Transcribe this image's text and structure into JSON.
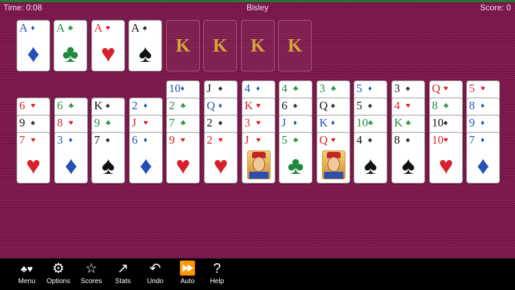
{
  "status": {
    "time": "Time: 0:08",
    "title": "Bisley",
    "score": "Score: 0"
  },
  "foundations": {
    "aces": [
      {
        "rank": "A",
        "suit": "diamonds"
      },
      {
        "rank": "A",
        "suit": "clubs"
      },
      {
        "rank": "A",
        "suit": "hearts"
      },
      {
        "rank": "A",
        "suit": "spades"
      }
    ],
    "king_slots": [
      "K",
      "K",
      "K",
      "K"
    ]
  },
  "tableau": [
    [
      {
        "rank": "6",
        "suit": "hearts"
      },
      {
        "rank": "9",
        "suit": "spades"
      },
      {
        "rank": "7",
        "suit": "hearts"
      }
    ],
    [
      {
        "rank": "6",
        "suit": "clubs"
      },
      {
        "rank": "8",
        "suit": "hearts"
      },
      {
        "rank": "3",
        "suit": "diamonds"
      }
    ],
    [
      {
        "rank": "K",
        "suit": "spades"
      },
      {
        "rank": "9",
        "suit": "clubs"
      },
      {
        "rank": "7",
        "suit": "spades"
      }
    ],
    [
      {
        "rank": "2",
        "suit": "diamonds"
      },
      {
        "rank": "J",
        "suit": "hearts"
      },
      {
        "rank": "6",
        "suit": "diamonds"
      }
    ],
    [
      {
        "rank": "10",
        "suit": "diamonds"
      },
      {
        "rank": "2",
        "suit": "clubs"
      },
      {
        "rank": "7",
        "suit": "clubs"
      },
      {
        "rank": "9",
        "suit": "hearts"
      }
    ],
    [
      {
        "rank": "J",
        "suit": "spades"
      },
      {
        "rank": "Q",
        "suit": "diamonds"
      },
      {
        "rank": "2",
        "suit": "spades"
      },
      {
        "rank": "2",
        "suit": "hearts"
      }
    ],
    [
      {
        "rank": "4",
        "suit": "diamonds"
      },
      {
        "rank": "K",
        "suit": "hearts"
      },
      {
        "rank": "3",
        "suit": "hearts"
      },
      {
        "rank": "J",
        "suit": "hearts"
      }
    ],
    [
      {
        "rank": "4",
        "suit": "clubs"
      },
      {
        "rank": "6",
        "suit": "spades"
      },
      {
        "rank": "J",
        "suit": "diamonds"
      },
      {
        "rank": "5",
        "suit": "clubs"
      }
    ],
    [
      {
        "rank": "3",
        "suit": "clubs"
      },
      {
        "rank": "Q",
        "suit": "spades"
      },
      {
        "rank": "K",
        "suit": "diamonds"
      },
      {
        "rank": "Q",
        "suit": "hearts"
      }
    ],
    [
      {
        "rank": "5",
        "suit": "diamonds"
      },
      {
        "rank": "5",
        "suit": "spades"
      },
      {
        "rank": "10",
        "suit": "clubs"
      },
      {
        "rank": "4",
        "suit": "spades"
      }
    ],
    [
      {
        "rank": "3",
        "suit": "spades"
      },
      {
        "rank": "4",
        "suit": "hearts"
      },
      {
        "rank": "K",
        "suit": "clubs"
      },
      {
        "rank": "8",
        "suit": "spades"
      }
    ],
    [
      {
        "rank": "Q",
        "suit": "hearts"
      },
      {
        "rank": "8",
        "suit": "clubs"
      },
      {
        "rank": "10",
        "suit": "spades"
      },
      {
        "rank": "10",
        "suit": "hearts"
      }
    ],
    [
      {
        "rank": "5",
        "suit": "hearts"
      },
      {
        "rank": "8",
        "suit": "diamonds"
      },
      {
        "rank": "9",
        "suit": "diamonds"
      },
      {
        "rank": "7",
        "suit": "diamonds"
      }
    ]
  ],
  "toolbar": [
    {
      "label": "Menu",
      "icon": "card-suits-icon"
    },
    {
      "label": "Options",
      "icon": "gears-icon"
    },
    {
      "label": "Scores",
      "icon": "star-icon"
    },
    {
      "label": "Stats",
      "icon": "chart-icon"
    },
    {
      "label": "Undo",
      "icon": "undo-icon"
    },
    {
      "label": "Auto",
      "icon": "fast-forward-icon"
    },
    {
      "label": "Help",
      "icon": "question-icon"
    }
  ],
  "colors": {
    "felt": "#7c1449",
    "status_line": "#1d7a31",
    "heart_red": "#d8202a",
    "diamond_blue": "#2450b8",
    "club_green": "#1e8a3a",
    "spade_black": "#111111",
    "king_gold": "#d8a33a"
  }
}
